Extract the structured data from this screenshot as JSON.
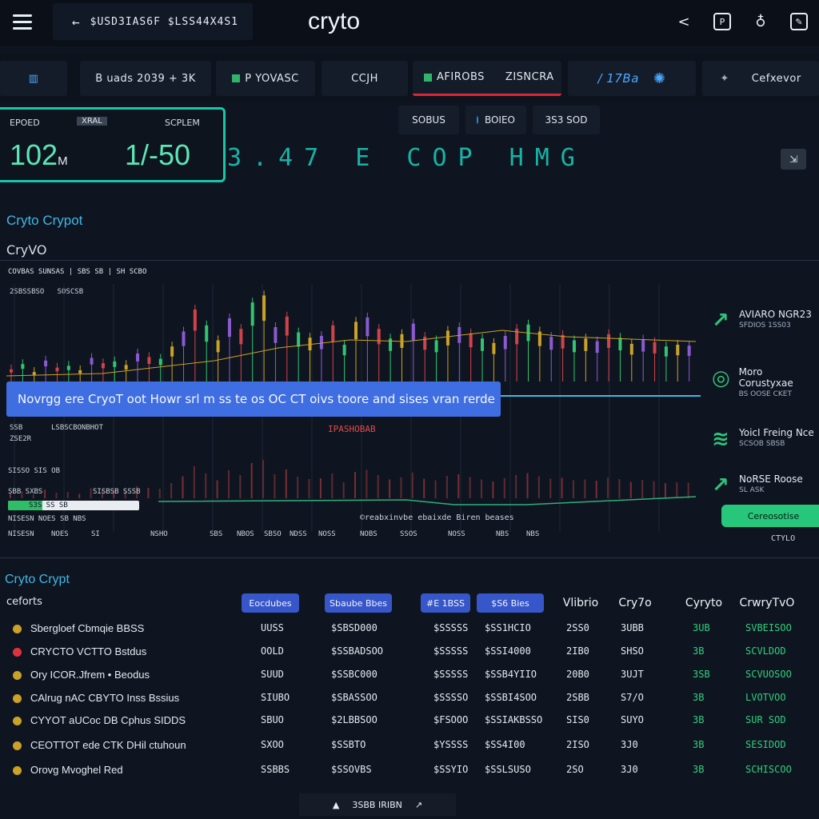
{
  "header": {
    "ticker": "$USD3IAS6F  $LSS44X4S1",
    "brand": "cryto",
    "icons": [
      "share-icon",
      "wallet-icon",
      "bell-icon",
      "edit-icon"
    ]
  },
  "nav": {
    "tabs": [
      "B uads  2039 + 3K",
      "P YOVASC",
      "CCJH",
      "AFIROBS",
      "ZISNCRA",
      "/ 17Ba",
      "Cefxevor"
    ]
  },
  "stat": {
    "label_left": "EPOED",
    "chip": "XRAL",
    "label_right": "SCPLEM",
    "value_left": "102",
    "value_left_unit": "M",
    "value_right": "1/-50",
    "big_ticker": "3.47 E  COP  HMG"
  },
  "pills": [
    "SOBUS",
    "BOIEO",
    "3S3 SOD"
  ],
  "section": {
    "title": "Cryto Crypot",
    "subtitle": "CryVO",
    "legend": "COVBAS  SUNSAS  |  SBS  SB  |  SH  SCBO",
    "label_a": "2SBSSBSO",
    "label_b": "SOSCSB",
    "label_c": "SSB",
    "label_d": "ZSE2R",
    "label_e": "LSBSCBONBHOT",
    "label_f": "IPASHOBAB"
  },
  "banner": {
    "text": "Novrgg ere CryoT oot Howr srl m ss te os OC CT oivs toore and sises vran rerde"
  },
  "volume_labels": {
    "l1": "SISSO  SIS OB",
    "l2": "SBB  SXBS",
    "l3": "SISBSB SSSB",
    "progress_text": "S3S  SS   SB",
    "axis": [
      "NISESN",
      "NOES",
      "SI",
      "NSHO",
      "SBS",
      "NBOS",
      "SBSO",
      "NDSS",
      "NOSS",
      "NOBS",
      "SSOS",
      "NOSS",
      "NBS",
      "NBS"
    ],
    "axis_bottom_note": "©reabxinvbe ebaixde Biren beases",
    "left_bottom": "NISESN  NOES  SB  NBS",
    "progress_value": 0.26
  },
  "rail": [
    {
      "icon": "trend-icon",
      "title": "AVIARO NGR23",
      "sub": "SFDIOS 1SS03"
    },
    {
      "icon": "exchange-icon",
      "title": "Moro Corustyxae",
      "sub": "BS OOSE  CKET"
    },
    {
      "icon": "signal-icon",
      "title": "YoicI Freing Nce",
      "sub": "SCSOB  SBSB"
    },
    {
      "icon": "trend-icon",
      "title": "NoRSE Roose",
      "sub": "SL ASK"
    }
  ],
  "rail_button": "Cereosotise",
  "rail_footer": "CTYLO",
  "table": {
    "title": "Cryto Crypt",
    "first_col": "ceforts",
    "headers": [
      "Eocdubes",
      "Sbaube Bbes",
      "#E 1BSS",
      "$S6 Bies",
      "Vlibrio",
      "Cry7o",
      "Cyryto",
      "CrwryTvO"
    ],
    "rows": [
      {
        "color": "#c9a227",
        "name": "Sbergloef Cbmqie BBSS",
        "c1": "UUSS",
        "c2": "$SBSD000",
        "c3": "$SSSSS",
        "c4": "$SS1HCIO",
        "c5": "2SS0",
        "c6": "3UBB",
        "c7": "3UB",
        "c8": "SVBEISOO"
      },
      {
        "color": "#e0323d",
        "name": "CRYCTO VCTTO Bstdus",
        "c1": "OOLD",
        "c2": "$SSBADSOO",
        "c3": "$SSSSS",
        "c4": "$SSI4000",
        "c5": "2IB0",
        "c6": "SHSO",
        "c7": "3B",
        "c8": "SCVLDOD"
      },
      {
        "color": "#c9a227",
        "name": "Ory ICOR.Jfrem  •  Beodus",
        "c1": "SUUD",
        "c2": "$SSBC000",
        "c3": "$SSSSS",
        "c4": "$SSB4YIIO",
        "c5": "20B0",
        "c6": "3UJT",
        "c7": "3SB",
        "c8": "SCVUOSOO"
      },
      {
        "color": "#c9a227",
        "name": "CAlrug nAC CBYTO Inss Bssius",
        "c1": "SIUBO",
        "c2": "$SBASSOO",
        "c3": "$SSSSO",
        "c4": "$SSBI4SOO",
        "c5": "2SBB",
        "c6": "S7/O",
        "c7": "3B",
        "c8": "LVOTVOO"
      },
      {
        "color": "#c9a227",
        "name": "CYYOT aUCoc   DB Cphus SIDDS",
        "c1": "SBUO",
        "c2": "$2LBBSOO",
        "c3": "$FSOOO",
        "c4": "$SSIAKBSSO",
        "c5": "SIS0",
        "c6": "SUYO",
        "c7": "3B",
        "c8": "SUR SOD"
      },
      {
        "color": "#c9a227",
        "name": "CEOTTOT ede CTK DHil ctuhoun",
        "c1": "SXOO",
        "c2": "$SSBTO",
        "c3": "$YSSSS",
        "c4": "$SS4I00",
        "c5": "2ISO",
        "c6": "3J0",
        "c7": "3B",
        "c8": "SESIDOD"
      },
      {
        "color": "#c9a227",
        "name": "Orovg Mvoghel Red",
        "c1": "SSBBS",
        "c2": "$SSOVBS",
        "c3": "$SSYIO",
        "c4": "$SSLSUSO",
        "c5": "2SO",
        "c6": "3J0",
        "c7": "3B",
        "c8": "SCHISCOO"
      }
    ]
  },
  "footer": {
    "text": "3SBB  IRIBN"
  },
  "chart_data": {
    "type": "bar",
    "series": [
      {
        "values": [
          12,
          18,
          9,
          22,
          14,
          16,
          11,
          25,
          19,
          21,
          17,
          30,
          26,
          24,
          38,
          55,
          80,
          62,
          45,
          70,
          58,
          88,
          96,
          60,
          72,
          54,
          48,
          50,
          62,
          40,
          66,
          71,
          58,
          47,
          52,
          64,
          49,
          45,
          56,
          60,
          53,
          47,
          42,
          50,
          58,
          63,
          55,
          49,
          51,
          45,
          47,
          44,
          52,
          48,
          41,
          46,
          43,
          38,
          40,
          39
        ]
      }
    ],
    "ylim": [
      0,
      100
    ]
  }
}
